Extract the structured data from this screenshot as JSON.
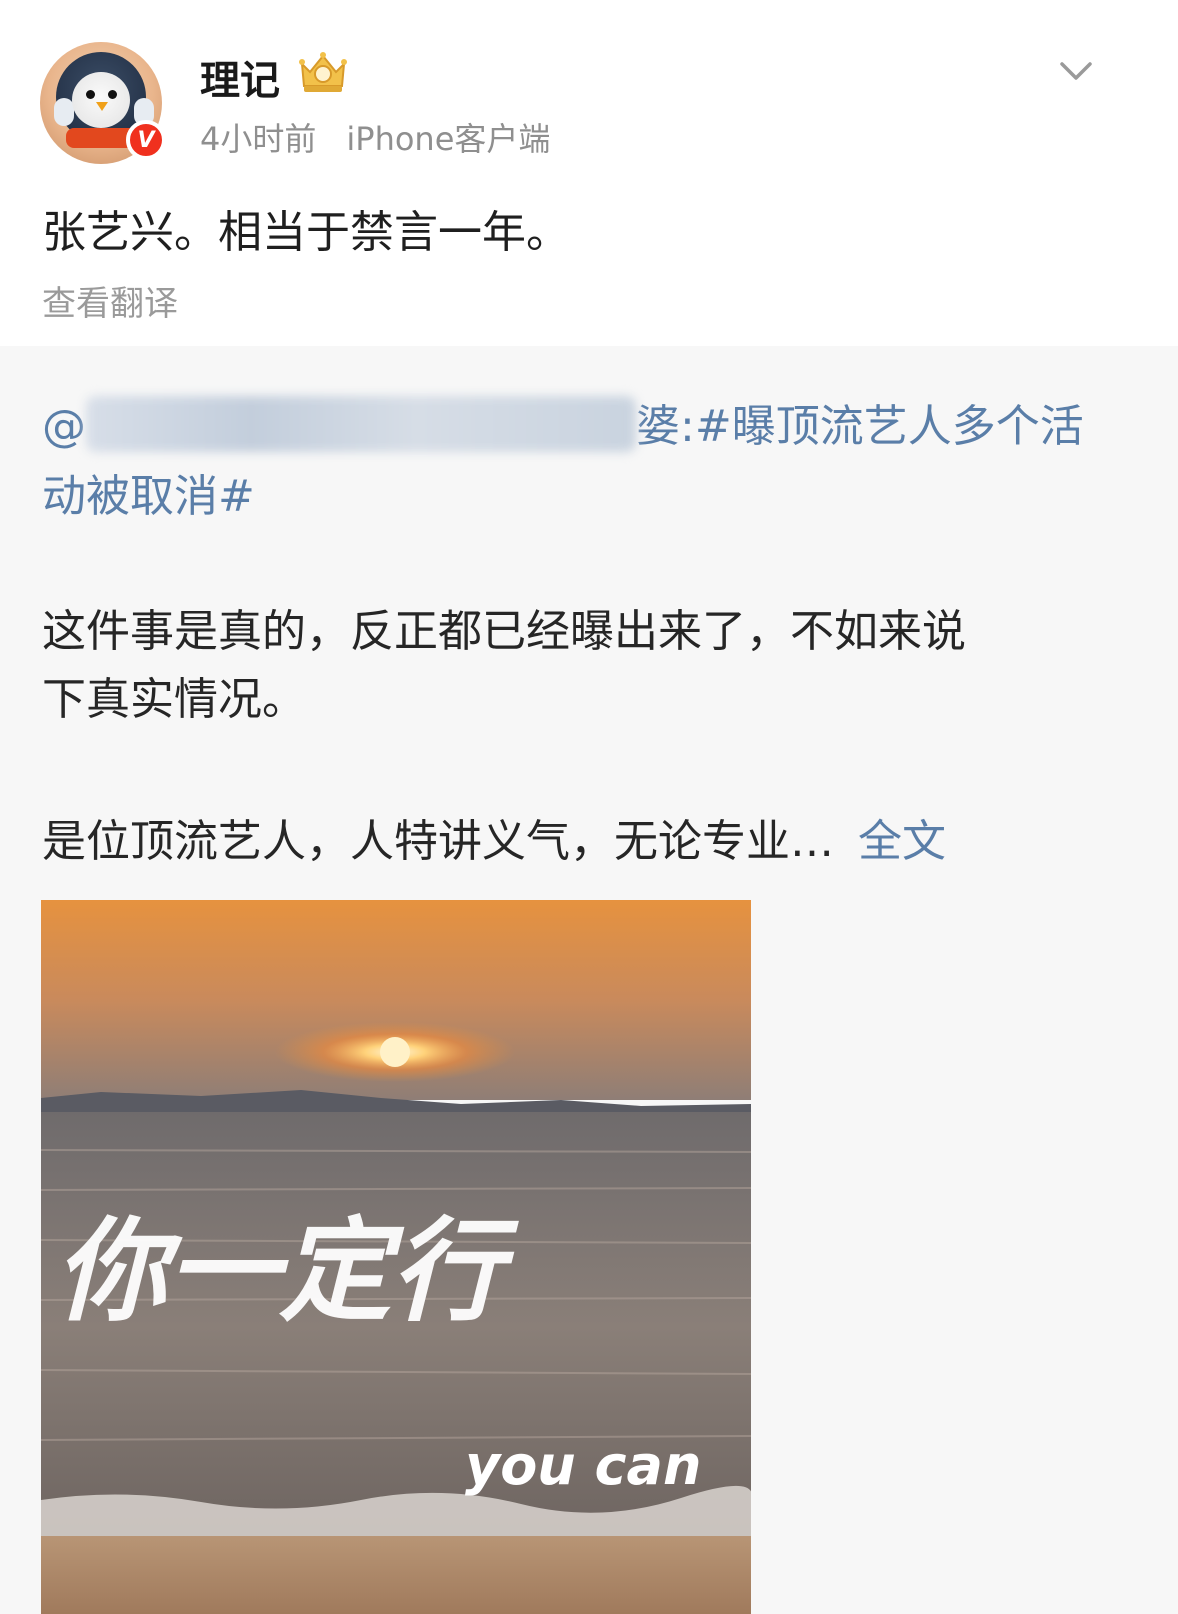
{
  "header": {
    "username": "理记",
    "time": "4小时前",
    "source": "iPhone客户端",
    "verified_label": "V"
  },
  "post": {
    "text": "张艺兴。相当于禁言一年。",
    "translate_label": "查看翻译"
  },
  "repost": {
    "at_prefix": "@",
    "name_tail": "婆",
    "hashtag_part1": ":#曝顶流艺人多个活",
    "hashtag_part2": "动被取消#",
    "line_a": "这件事是真的，反正都已经曝出来了，不如来说",
    "line_b": "下真实情况。",
    "line_c": "是位顶流艺人，人特讲义气，无论专业…",
    "fulltext_label": "全文"
  },
  "image": {
    "calligraphy": "你一定行",
    "caption": "you can"
  },
  "colors": {
    "link": "#5a7ea8",
    "verified": "#f0301e",
    "meta": "#8f8f8f"
  }
}
